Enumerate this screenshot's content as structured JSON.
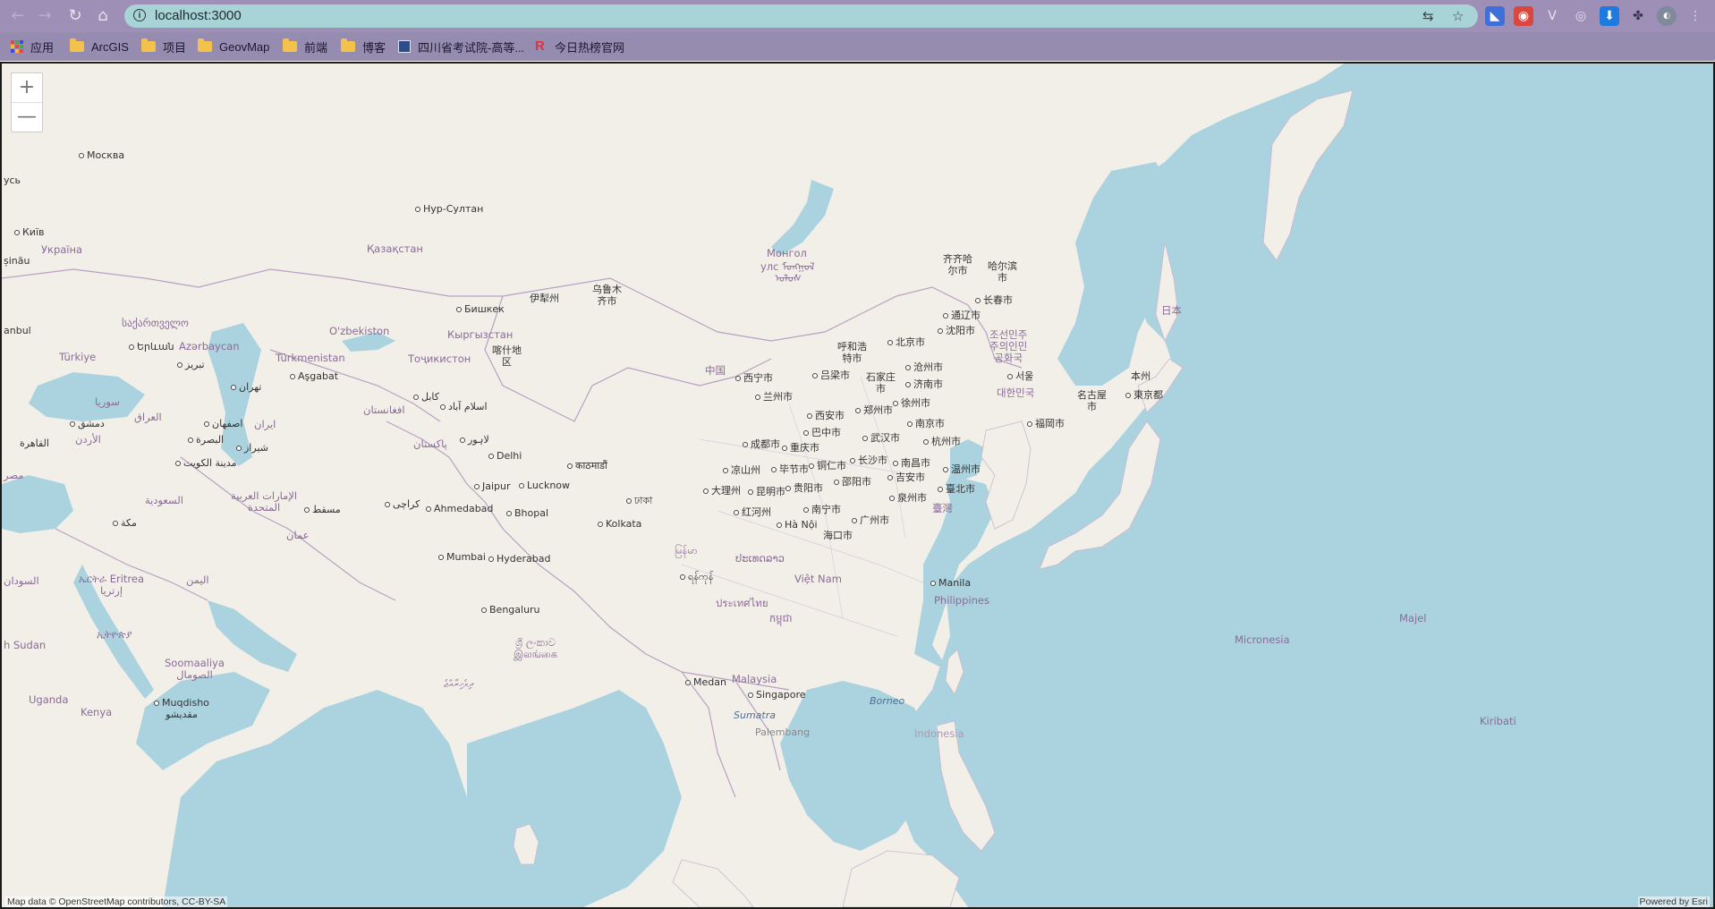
{
  "browser": {
    "back_icon": "arrow-left-icon",
    "forward_icon": "arrow-right-icon",
    "reload_icon": "reload-icon",
    "home_icon": "home-icon",
    "url": "localhost:3000"
  },
  "bookmarks": [
    {
      "label": "应用",
      "kind": "apps"
    },
    {
      "label": "ArcGIS",
      "kind": "folder"
    },
    {
      "label": "项目",
      "kind": "folder"
    },
    {
      "label": "GeovMap",
      "kind": "folder"
    },
    {
      "label": "前端",
      "kind": "folder"
    },
    {
      "label": "博客",
      "kind": "folder"
    },
    {
      "label": "四川省考试院-高等...",
      "kind": "site"
    },
    {
      "label": "今日热榜官网",
      "kind": "site"
    }
  ],
  "map": {
    "zoom_in": "+",
    "zoom_out": "—",
    "attribution_left": "Map data © OpenStreetMap contributors, CC-BY-SA",
    "attribution_right": "Powered by Esri",
    "labels": {
      "moskva": "Москва",
      "kyiv": "Київ",
      "ukraina": "Україна",
      "nursultan": "Нур-Султан",
      "kazakhstan": "Қазақстан",
      "mongol": "Монгол",
      "mongol2": "улс ᠮᠣᠩᠭᠣᠯ",
      "urumqi": "乌鲁木\n齐市",
      "yili": "伊犁州",
      "bishkek": "Бишкек",
      "kyrgyz": "Кыргызстан",
      "uzbek": "O'zbekiston",
      "turkmen": "Türkmenistan",
      "asgabat": "Aşgabat",
      "tajik": "Тоҷикистон",
      "kashgar": "喀什地\n区",
      "georgia": "საქართველო",
      "yerevan": "Երևան",
      "azer": "Azərbaycan",
      "turkiye": "Türkiye",
      "tabriz": "تبریز",
      "tehran": "تهران",
      "iran": "ایران",
      "isfahan": "اصفهان",
      "shiraz": "شیراز",
      "kabul": "کابل",
      "afghanistan": "افغانستان",
      "islamabad": "اسلام آباد",
      "pakistan": "پاکستان",
      "lahore": "لاہور",
      "delhi": "Delhi",
      "jaipur": "Jaipur",
      "lucknow": "Lucknow",
      "ahmedabad": "Ahmedabad",
      "bhopal": "Bhopal",
      "karachi": "کراچی",
      "mumbai": "Mumbai",
      "hyderabad": "Hyderabad",
      "bengaluru": "Bengaluru",
      "kolkata": "Kolkata",
      "dhaka": "ঢাকা",
      "kathmandu": "काठमाडौं",
      "srilanka": "ශ්‍රී ලංකාව\nஇலங்கை",
      "maldives": "ދިވެހިރާއްޖެ",
      "syria": "سوريا",
      "damascus": "دمشق",
      "iraq": "العراق",
      "jordan": "الأردن",
      "cairo": "القاهرة",
      "basra": "البصرة",
      "kuwait": "مدينة الكويت",
      "saudi": "السعودية",
      "mecca": "مكة",
      "uae": "الإمارات العربية\nالمتحدة",
      "muscat": "مسقط",
      "oman": "عمان",
      "yemen": "اليمن",
      "sudan": "السودان",
      "eritrea": "ኤርትራ Eritrea\nإرتريا",
      "ethiopia": "ኢትዮጵያ",
      "southsudan": "h Sudan",
      "somalia": "Soomaaliya\nالصومال",
      "uganda": "Uganda",
      "kenya": "Kenya",
      "mogadishu": "Muqdisho\nمقديشو",
      "misr": "مصر",
      "china": "中国",
      "qiqihar": "齐齐哈\n尔市",
      "harbin": "哈尔滨\n市",
      "changchun": "长春市",
      "tongliao": "通辽市",
      "shenyang": "沈阳市",
      "hohhot": "呼和浩\n特市",
      "beijing": "北京市",
      "cangzhou": "沧州市",
      "lvliang": "吕梁市",
      "shijiazhuang": "石家庄\n市",
      "jinan": "济南市",
      "xining": "西宁市",
      "lanzhou": "兰州市",
      "xuzhou": "徐州市",
      "xian": "西安市",
      "zhengzhou": "郑州市",
      "nanjing": "南京市",
      "bazhong": "巴中市",
      "wuhan": "武汉市",
      "hangzhou": "杭州市",
      "chengdu": "成都市",
      "chongqing": "重庆市",
      "tongren": "铜仁市",
      "changsha": "长沙市",
      "nanchang": "南昌市",
      "wenzhou": "温州市",
      "liangshan": "凉山州",
      "bijie": "毕节市",
      "guiyang": "贵阳市",
      "shaoyang": "邵阳市",
      "jian": "吉安市",
      "dali": "大理州",
      "kunming": "昆明市",
      "quanzhou": "泉州市",
      "taipei": "臺北市",
      "taiwan": "臺灣",
      "honghe": "红河州",
      "nanning": "南宁市",
      "guangzhou": "广州市",
      "hanoi": "Hà Nội",
      "haikou": "海口市",
      "korea_n": "조선민주\n주의인민\n공화국",
      "seoul": "서울",
      "korea_s": "대한민국",
      "japan": "日本",
      "honshu": "本州",
      "nagoya": "名古屋\n市",
      "tokyo": "東京都",
      "fukuoka": "福岡市",
      "myanmar": "မြန်မာ",
      "yangon": "ရန်ကုန်",
      "laos": "ປະເທດລາວ",
      "thailand": "ประเทศไทย",
      "vietnam": "Việt Nam",
      "cambodia": "កម្ពុជា",
      "manila": "Manila",
      "philippines": "Philippines",
      "malaysia": "Malaysia",
      "singapore": "Singapore",
      "medan": "Medan",
      "borneo": "Borneo",
      "sumatra": "Sumatra",
      "palembang": "Palembang",
      "indonesia": "Indonesia",
      "micronesia": "Micronesia",
      "majel": "Majel",
      "kiribati": "Kiribati",
      "beijing_mongol": "ᠤᠯᠤᠰ",
      "inau": "șinău",
      "anbul": "anbul",
      "belarus": "усь"
    }
  }
}
